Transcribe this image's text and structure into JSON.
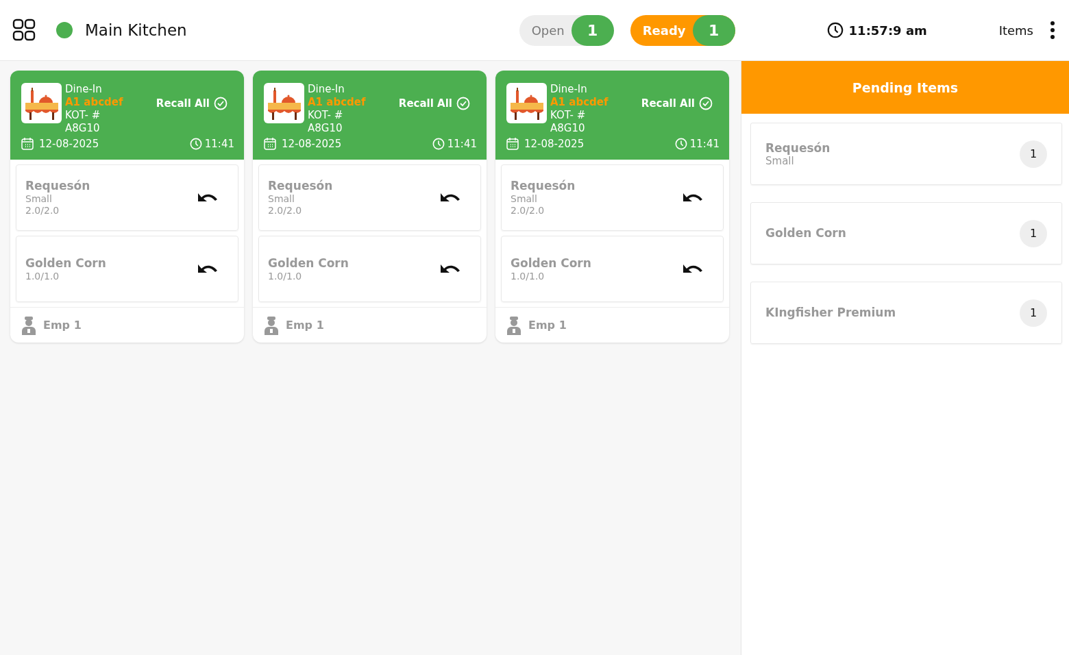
{
  "header": {
    "kitchen": "Main Kitchen",
    "online": true,
    "filters": [
      {
        "label": "Open",
        "count": "1",
        "selected": false
      },
      {
        "label": "Ready",
        "count": "1",
        "selected": true
      }
    ],
    "time": "11:57:9 am",
    "items_link": "Items"
  },
  "orders": [
    {
      "type": "Dine-In",
      "table": "A1 abcdef",
      "kot_label": "KOT- #",
      "kot": "A8G10",
      "recall": "Recall All",
      "date": "12-08-2025",
      "time": "11:41",
      "items": [
        {
          "name": "Requesón",
          "variant": "Small",
          "qty": "2.0/2.0"
        },
        {
          "name": "Golden Corn",
          "qty": "1.0/1.0"
        }
      ],
      "employee": "Emp 1"
    },
    {
      "type": "Dine-In",
      "table": "A1 abcdef",
      "kot_label": "KOT- #",
      "kot": "A8G10",
      "recall": "Recall All",
      "date": "12-08-2025",
      "time": "11:41",
      "items": [
        {
          "name": "Requesón",
          "variant": "Small",
          "qty": "2.0/2.0"
        },
        {
          "name": "Golden Corn",
          "qty": "1.0/1.0"
        }
      ],
      "employee": "Emp 1"
    },
    {
      "type": "Dine-In",
      "table": "A1 abcdef",
      "kot_label": "KOT- #",
      "kot": "A8G10",
      "recall": "Recall All",
      "date": "12-08-2025",
      "time": "11:41",
      "items": [
        {
          "name": "Requesón",
          "variant": "Small",
          "qty": "2.0/2.0"
        },
        {
          "name": "Golden Corn",
          "qty": "1.0/1.0"
        }
      ],
      "employee": "Emp 1"
    }
  ],
  "pending": {
    "title": "Pending Items",
    "items": [
      {
        "name": "Requesón",
        "variant": "Small",
        "count": "1"
      },
      {
        "name": "Golden Corn",
        "count": "1"
      },
      {
        "name": "KIngfisher Premium",
        "count": "1"
      }
    ]
  }
}
